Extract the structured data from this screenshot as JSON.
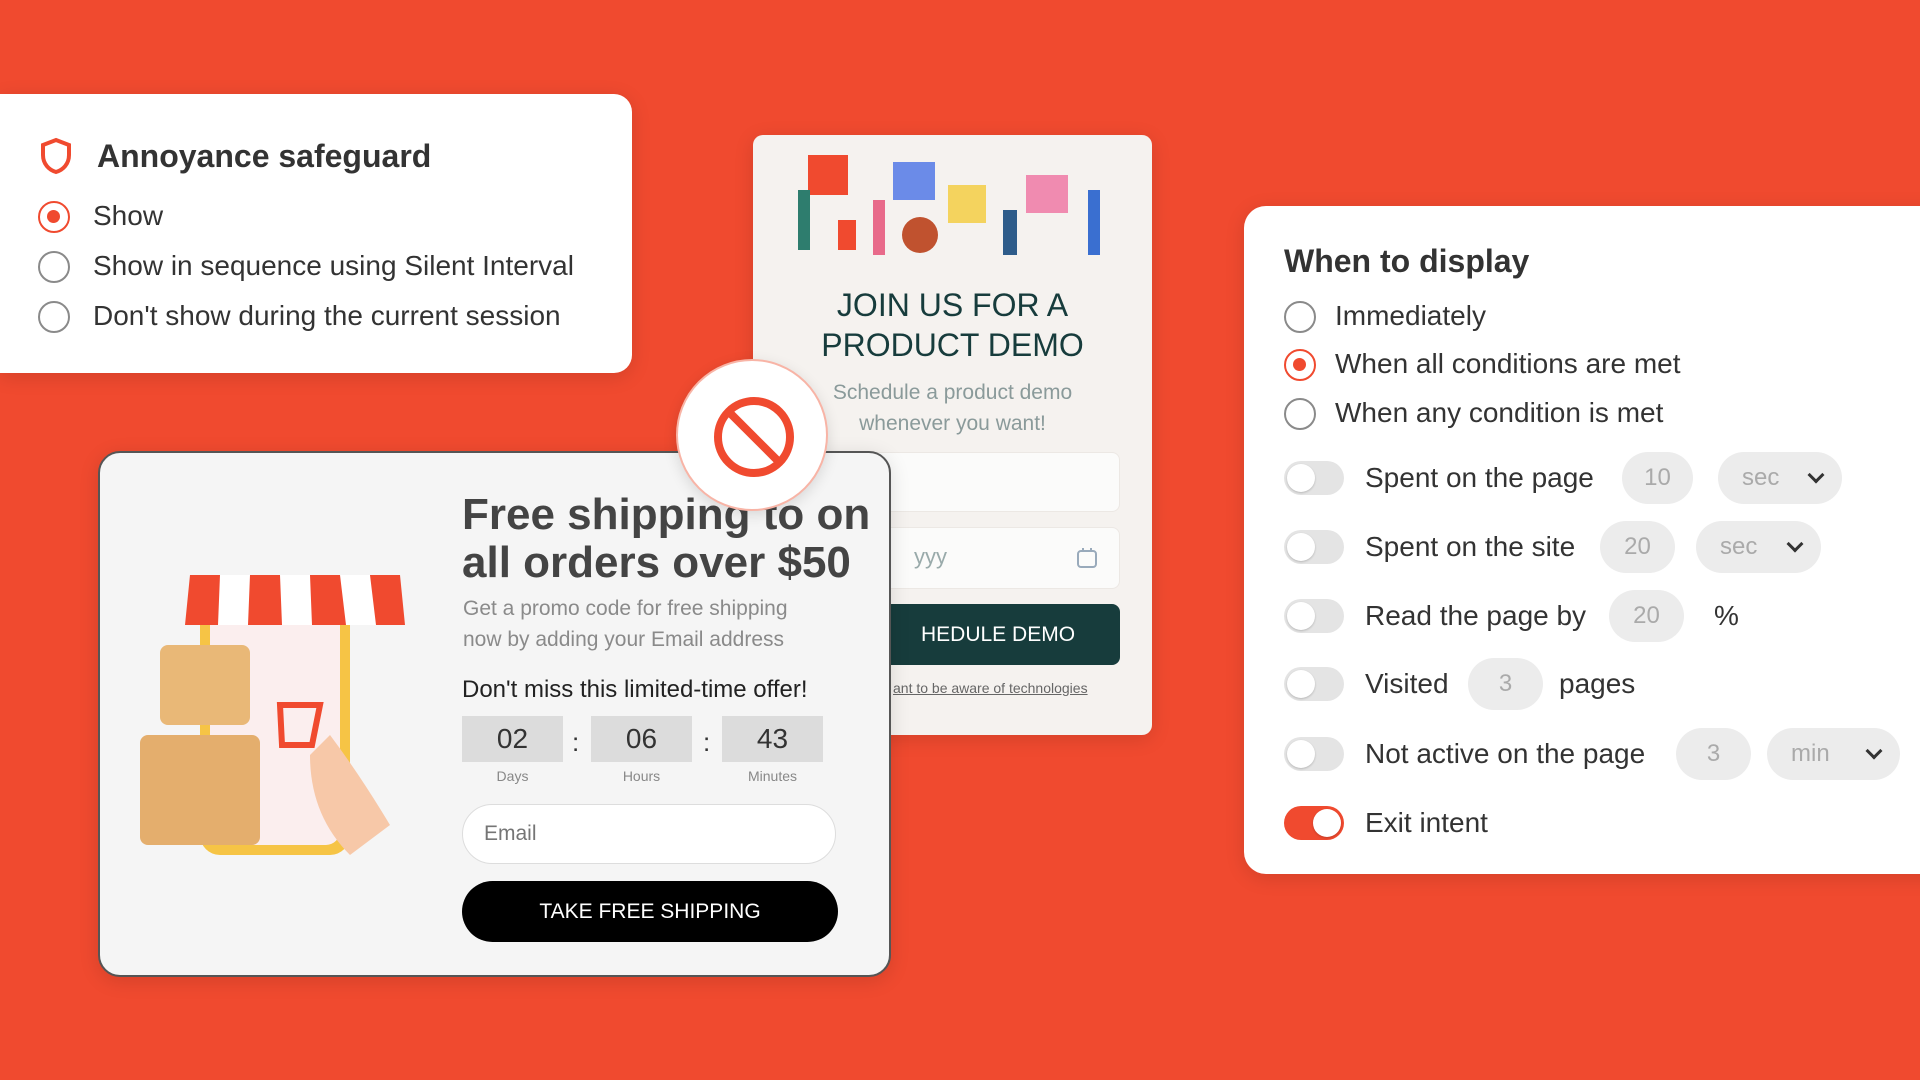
{
  "safeguard": {
    "title": "Annoyance safeguard",
    "options": [
      "Show",
      "Show in sequence using Silent Interval",
      "Don't show during the current session"
    ],
    "selected": 0
  },
  "demo": {
    "heading_line1": "JOIN US FOR A",
    "heading_line2": "PRODUCT DEMO",
    "sub_line1": "Schedule a product demo",
    "sub_line2": "whenever you want!",
    "date_placeholder": "yyy",
    "button": "HEDULE DEMO",
    "link": "ant to be aware of technologies"
  },
  "shipping": {
    "heading_line1": "Free shipping to on",
    "heading_line2": "all orders over $50",
    "sub_line1": "Get a promo code for free shipping",
    "sub_line2": "now by adding your Email address",
    "offer": "Don't miss this limited-time offer!",
    "countdown": [
      {
        "value": "02",
        "label": "Days"
      },
      {
        "value": "06",
        "label": "Hours"
      },
      {
        "value": "43",
        "label": "Minutes"
      }
    ],
    "separator": ":",
    "email_placeholder": "Email",
    "button": "TAKE FREE SHIPPING"
  },
  "display": {
    "title": "When to display",
    "options": [
      "Immediately",
      "When all conditions are met",
      "When any condition is met"
    ],
    "selected": 1,
    "conditions": [
      {
        "label": "Spent on the page",
        "value": "10",
        "unit": "sec",
        "enabled": false
      },
      {
        "label": "Spent on the site",
        "value": "20",
        "unit": "sec",
        "enabled": false
      },
      {
        "label": "Read the page by",
        "value": "20",
        "unit": "%",
        "enabled": false
      },
      {
        "label": "Visited",
        "value": "3",
        "unit": "pages",
        "enabled": false
      },
      {
        "label": "Not active on the page",
        "value": "3",
        "unit": "min",
        "enabled": false
      },
      {
        "label": "Exit intent",
        "enabled": true
      }
    ]
  },
  "colors": {
    "accent": "#F04A2F",
    "demo_button": "#173C3C"
  }
}
